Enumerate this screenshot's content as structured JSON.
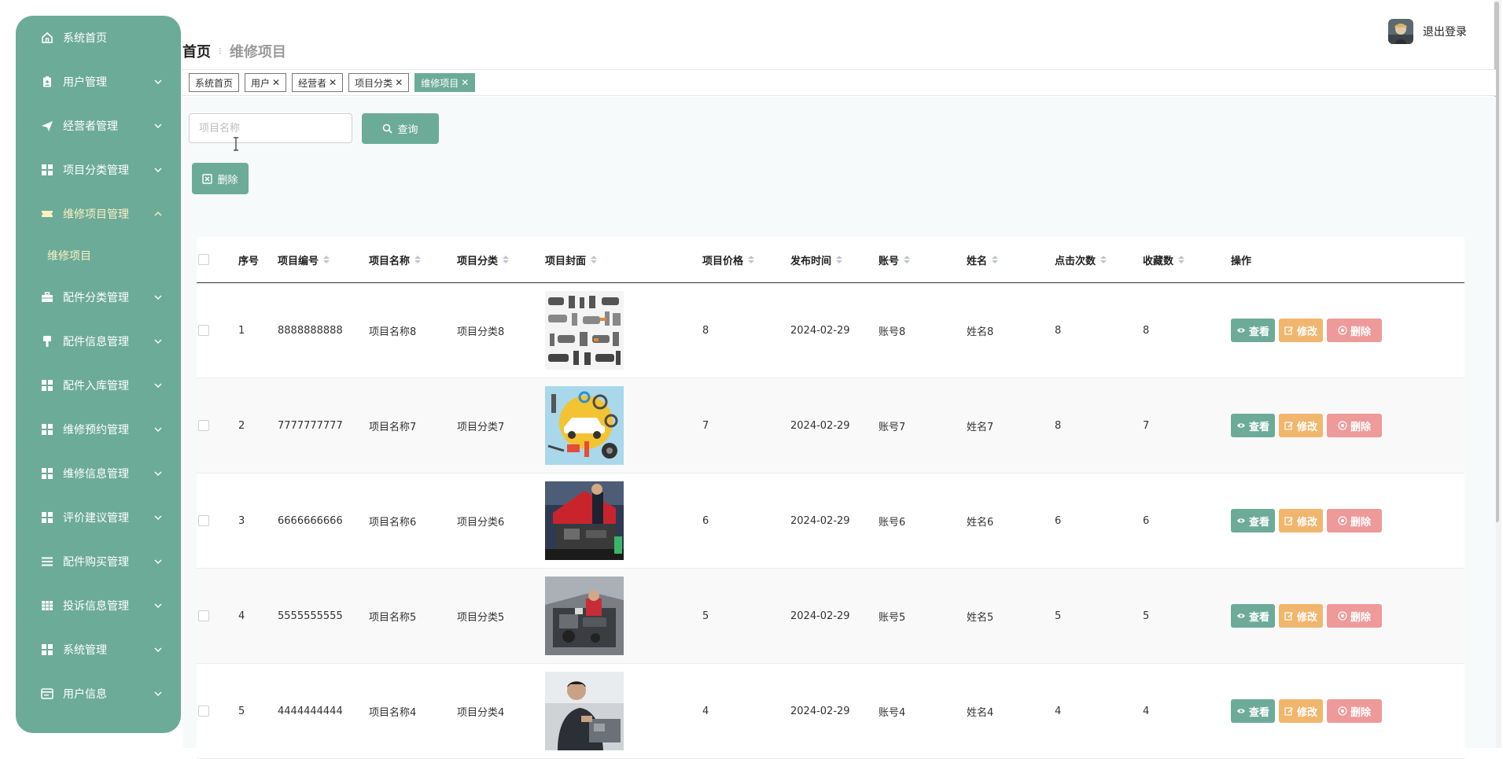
{
  "sidebar": {
    "items": [
      {
        "label": "系统首页",
        "icon": "home-icon",
        "expandable": false
      },
      {
        "label": "用户管理",
        "icon": "clipboard-user-icon",
        "expandable": true
      },
      {
        "label": "经营者管理",
        "icon": "paper-plane-icon",
        "expandable": true
      },
      {
        "label": "项目分类管理",
        "icon": "grid-icon",
        "expandable": true
      },
      {
        "label": "维修项目管理",
        "icon": "ticket-icon",
        "expandable": true,
        "expanded": true,
        "active": true,
        "children": [
          {
            "label": "维修项目"
          }
        ]
      },
      {
        "label": "配件分类管理",
        "icon": "briefcase-icon",
        "expandable": true
      },
      {
        "label": "配件信息管理",
        "icon": "brush-icon",
        "expandable": true
      },
      {
        "label": "配件入库管理",
        "icon": "grid-icon",
        "expandable": true
      },
      {
        "label": "维修预约管理",
        "icon": "grid-icon",
        "expandable": true
      },
      {
        "label": "维修信息管理",
        "icon": "grid-icon",
        "expandable": true
      },
      {
        "label": "评价建议管理",
        "icon": "grid-icon",
        "expandable": true
      },
      {
        "label": "配件购买管理",
        "icon": "list-icon",
        "expandable": true
      },
      {
        "label": "投诉信息管理",
        "icon": "table-icon",
        "expandable": true
      },
      {
        "label": "系统管理",
        "icon": "grid-icon",
        "expandable": true
      },
      {
        "label": "用户信息",
        "icon": "id-card-icon",
        "expandable": true
      }
    ]
  },
  "header": {
    "breadcrumb_home": "首页",
    "breadcrumb_separator": "⁝",
    "breadcrumb_current": "维修项目",
    "logout_label": "退出登录"
  },
  "tags": [
    {
      "label": "系统首页",
      "closable": false,
      "active": false
    },
    {
      "label": "用户",
      "closable": true,
      "active": false
    },
    {
      "label": "经营者",
      "closable": true,
      "active": false
    },
    {
      "label": "项目分类",
      "closable": true,
      "active": false
    },
    {
      "label": "维修项目",
      "closable": true,
      "active": true
    }
  ],
  "search": {
    "placeholder": "项目名称",
    "value": "",
    "query_label": "查询",
    "batch_delete_label": "删除"
  },
  "table": {
    "columns": [
      "序号",
      "项目编号",
      "项目名称",
      "项目分类",
      "项目封面",
      "项目价格",
      "发布时间",
      "账号",
      "姓名",
      "点击次数",
      "收藏数",
      "操作"
    ],
    "rows": [
      {
        "index": "1",
        "code": "8888888888",
        "name": "项目名称8",
        "category": "项目分类8",
        "cover": "mechanics-collage",
        "price": "8",
        "date": "2024-02-29",
        "account": "账号8",
        "person": "姓名8",
        "clicks": "8",
        "favorites": "8"
      },
      {
        "index": "2",
        "code": "7777777777",
        "name": "项目名称7",
        "category": "项目分类7",
        "cover": "car-tools-illustration",
        "price": "7",
        "date": "2024-02-29",
        "account": "账号7",
        "person": "姓名7",
        "clicks": "8",
        "favorites": "7"
      },
      {
        "index": "3",
        "code": "6666666666",
        "name": "项目名称6",
        "category": "项目分类6",
        "cover": "red-car-hood",
        "price": "6",
        "date": "2024-02-29",
        "account": "账号6",
        "person": "姓名6",
        "clicks": "6",
        "favorites": "6"
      },
      {
        "index": "4",
        "code": "5555555555",
        "name": "项目名称5",
        "category": "项目分类5",
        "cover": "engine-bay",
        "price": "5",
        "date": "2024-02-29",
        "account": "账号5",
        "person": "姓名5",
        "clicks": "5",
        "favorites": "5"
      },
      {
        "index": "5",
        "code": "4444444444",
        "name": "项目名称4",
        "category": "项目分类4",
        "cover": "mechanic-working",
        "price": "4",
        "date": "2024-02-29",
        "account": "账号4",
        "person": "姓名4",
        "clicks": "4",
        "favorites": "4"
      }
    ],
    "actions": {
      "view": "查看",
      "edit": "修改",
      "delete": "删除"
    }
  },
  "colors": {
    "primary": "#6dab99",
    "active_text": "#fdf0c2",
    "edit": "#f1b66d",
    "delete": "#ee9a9a"
  }
}
